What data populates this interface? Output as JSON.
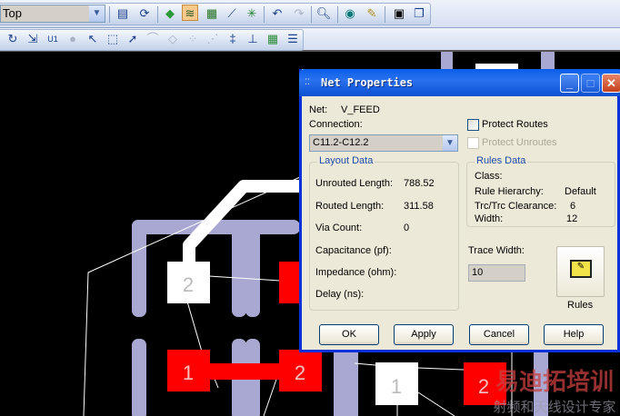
{
  "toolbar": {
    "layer_value": "Top",
    "row1_icons": [
      "properties-icon",
      "refresh-icon",
      "design-icon",
      "route-icon",
      "pcb-icon",
      "add-route-icon",
      "cluster-icon",
      "undo-icon",
      "redo-icon",
      "zoom-icon",
      "view-icon",
      "brush-icon",
      "image-icon",
      "window-icon"
    ],
    "row2_icons": [
      "rotate-icon",
      "move-icon",
      "component-icon",
      "disabled-icon",
      "select-icon",
      "area-select-icon",
      "net-select-icon",
      "disabled-trace-icon",
      "disabled-shape-icon",
      "disabled-pins-icon",
      "disabled-fanout-icon",
      "align-icon",
      "via-icon",
      "grid-icon",
      "list-icon"
    ]
  },
  "canvas": {
    "pads": [
      {
        "label": "2",
        "color": "#ffffff"
      },
      {
        "label": "1",
        "color": "#ff0000"
      },
      {
        "label": "2",
        "color": "#ff0000"
      },
      {
        "label": "1",
        "color": "#ffffff"
      },
      {
        "label": "2",
        "color": "#ff0000"
      }
    ],
    "watermark": {
      "main": "易迪拓培训",
      "sub": "射频和天线设计专家"
    }
  },
  "dialog": {
    "title": "Net Properties",
    "net_label": "Net:",
    "net_value": "V_FEED",
    "connection_label": "Connection:",
    "connection_value": "C11.2-C12.2",
    "protect_routes": {
      "label": "Protect Routes",
      "checked": false
    },
    "protect_unroutes": {
      "label": "Protect Unroutes",
      "checked": false,
      "disabled": true
    },
    "layout_data": {
      "title": "Layout Data",
      "rows": [
        {
          "label": "Unrouted Length:",
          "value": "788.52"
        },
        {
          "label": "Routed Length:",
          "value": "311.58"
        },
        {
          "label": "Via Count:",
          "value": "0"
        },
        {
          "label": "Capacitance (pf):",
          "value": ""
        },
        {
          "label": "Impedance (ohm):",
          "value": ""
        },
        {
          "label": "Delay (ns):",
          "value": ""
        }
      ]
    },
    "rules_data": {
      "title": "Rules Data",
      "rows": [
        {
          "label": "Class:",
          "value": ""
        },
        {
          "label": "Rule Hierarchy:",
          "value": "Default"
        },
        {
          "label": "Trc/Trc Clearance:",
          "value": "6"
        },
        {
          "label": "Width:",
          "value": "12"
        }
      ]
    },
    "trace_width_label": "Trace Width:",
    "trace_width_value": "10",
    "rules_button": "Rules",
    "buttons": {
      "ok": "OK",
      "apply": "Apply",
      "cancel": "Cancel",
      "help": "Help"
    }
  }
}
